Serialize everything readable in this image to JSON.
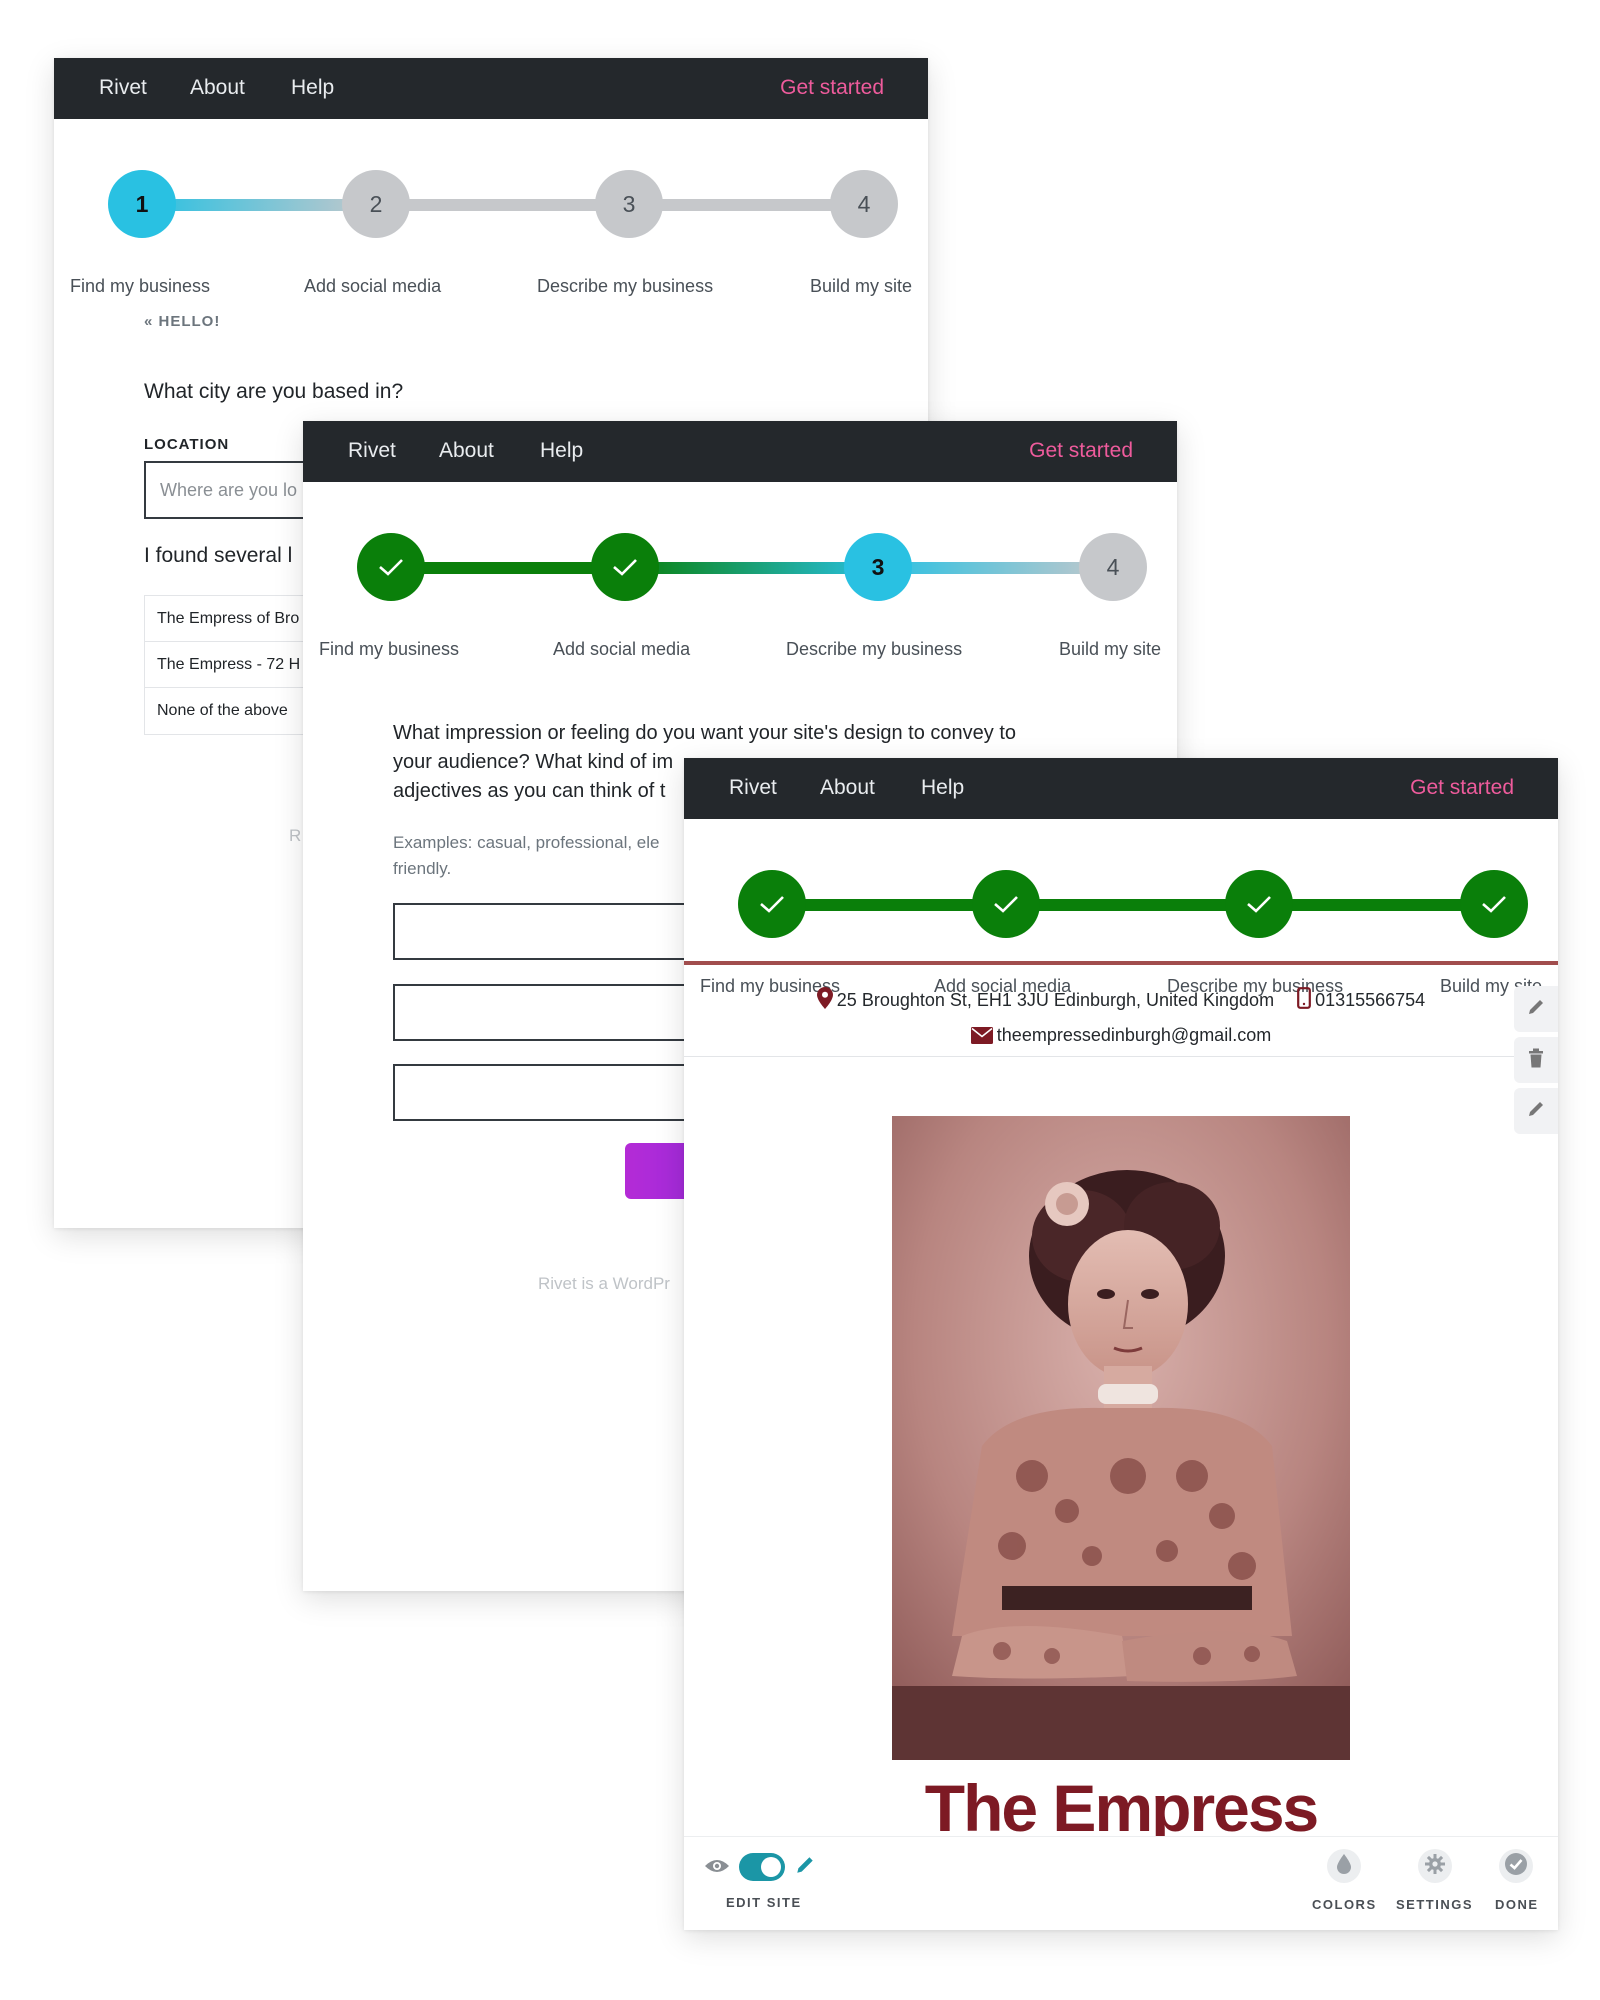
{
  "nav": {
    "brand": "Rivet",
    "about": "About",
    "help": "Help",
    "cta": "Get started"
  },
  "steps": [
    "Find my business",
    "Add social media",
    "Describe my business",
    "Build my site"
  ],
  "step_numbers": [
    "1",
    "2",
    "3",
    "4"
  ],
  "colors": {
    "nav_bg": "#24282c",
    "cta": "#ee5b9c",
    "current_step": "#29c1e2",
    "done_step": "#0a7f0a",
    "pending_step": "#c6c8cb",
    "brand_red": "#7d1a24",
    "toggle": "#1b96a6"
  },
  "window1": {
    "breadcrumb": "« HELLO!",
    "question": "What city are you based in?",
    "location_label": "LOCATION",
    "location_placeholder": "Where are you lo",
    "found_text": "I found several l",
    "results": [
      "The Empress of Bro",
      "The Empress - 72 H",
      "None of the above"
    ],
    "footer": "R"
  },
  "window2": {
    "question_lines": [
      "What impression or feeling do you want your site's design to convey to",
      "your audience? What kind of im",
      "adjectives as you can think of t"
    ],
    "examples_lines": [
      "Examples: casual, professional, ele",
      "friendly."
    ],
    "footer": "Rivet is a WordPr"
  },
  "window3": {
    "address": "25 Broughton St, EH1 3JU Edinburgh, United Kingdom",
    "phone": "01315566754",
    "email": "theempressedinburgh@gmail.com",
    "business_name": "The Empress",
    "toolbar": {
      "edit_label": "EDIT SITE",
      "edit_mode_on": true,
      "colors_label": "COLORS",
      "settings_label": "SETTINGS",
      "done_label": "DONE"
    },
    "side_icons": [
      "pencil-icon",
      "trash-icon",
      "pencil-icon"
    ]
  }
}
